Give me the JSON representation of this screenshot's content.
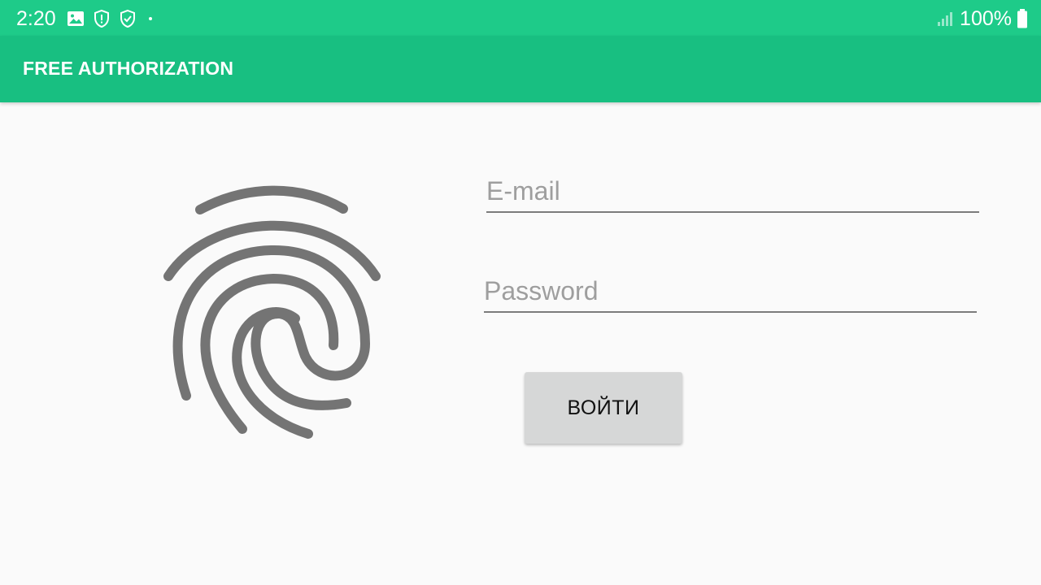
{
  "status_bar": {
    "time": "2:20",
    "battery": "100%",
    "icons": [
      "image-icon",
      "shield-alert-icon",
      "shield-check-icon",
      "dot-icon",
      "signal-icon",
      "battery-icon"
    ],
    "background": "#1ecb89"
  },
  "app_bar": {
    "title": "FREE AUTHORIZATION",
    "background": "#18bf81"
  },
  "login_form": {
    "fingerprint_icon": "fingerprint-icon",
    "email_placeholder": "E-mail",
    "password_placeholder": "Password",
    "login_button_label": "ВОЙТИ",
    "button_color": "#d6d7d7"
  }
}
